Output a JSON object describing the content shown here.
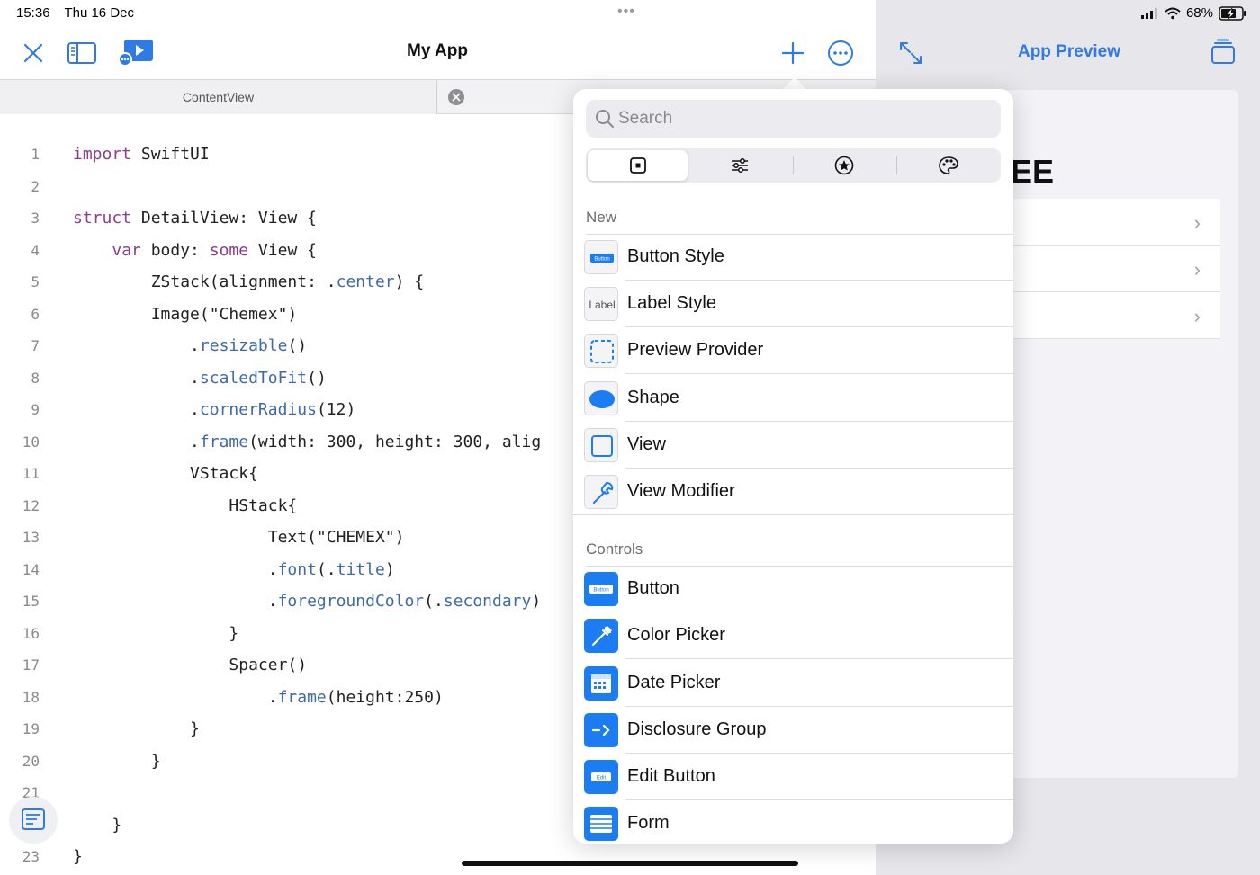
{
  "status": {
    "time": "15:36",
    "date": "Thu 16 Dec",
    "battery": "68%"
  },
  "editor": {
    "title": "My App",
    "tab_label": "ContentView",
    "code_lines": [
      {
        "n": "1",
        "text": "import SwiftUI"
      },
      {
        "n": "2",
        "text": ""
      },
      {
        "n": "3",
        "text": "struct DetailView: View {"
      },
      {
        "n": "4",
        "text": "    var body: some View {"
      },
      {
        "n": "5",
        "text": "        ZStack(alignment: .center) {"
      },
      {
        "n": "6",
        "text": "        Image(\"Chemex\")"
      },
      {
        "n": "7",
        "text": "            .resizable()"
      },
      {
        "n": "8",
        "text": "            .scaledToFit()"
      },
      {
        "n": "9",
        "text": "            .cornerRadius(12)"
      },
      {
        "n": "10",
        "text": "            .frame(width: 300, height: 300, alig"
      },
      {
        "n": "11",
        "text": "            VStack{"
      },
      {
        "n": "12",
        "text": "                HStack{"
      },
      {
        "n": "13",
        "text": "                    Text(\"CHEMEX\")"
      },
      {
        "n": "14",
        "text": "                    .font(.title)"
      },
      {
        "n": "15",
        "text": "                    .foregroundColor(.secondary)"
      },
      {
        "n": "16",
        "text": "                }"
      },
      {
        "n": "17",
        "text": "                Spacer()"
      },
      {
        "n": "18",
        "text": "                    .frame(height:250)"
      },
      {
        "n": "19",
        "text": "            }"
      },
      {
        "n": "20",
        "text": "        }"
      },
      {
        "n": "21",
        "text": ""
      },
      {
        "n": "22",
        "text": "    }"
      },
      {
        "n": "23",
        "text": "}"
      }
    ]
  },
  "preview": {
    "title": "App Preview",
    "heading_fragment": "EE"
  },
  "library": {
    "search_placeholder": "Search",
    "tabs": [
      "views-tab",
      "modifiers-tab",
      "snippets-tab",
      "colors-tab"
    ],
    "sections": [
      {
        "title": "New",
        "items": [
          {
            "label": "Button Style",
            "icon": "button-style-icon",
            "icon_text": "Button"
          },
          {
            "label": "Label Style",
            "icon": "label-style-icon",
            "icon_text": "Label"
          },
          {
            "label": "Preview Provider",
            "icon": "preview-provider-icon"
          },
          {
            "label": "Shape",
            "icon": "shape-icon"
          },
          {
            "label": "View",
            "icon": "view-icon"
          },
          {
            "label": "View Modifier",
            "icon": "view-modifier-icon"
          }
        ]
      },
      {
        "title": "Controls",
        "items": [
          {
            "label": "Button",
            "icon": "button-icon",
            "icon_text": "Button"
          },
          {
            "label": "Color Picker",
            "icon": "color-picker-icon"
          },
          {
            "label": "Date Picker",
            "icon": "date-picker-icon"
          },
          {
            "label": "Disclosure Group",
            "icon": "disclosure-group-icon"
          },
          {
            "label": "Edit Button",
            "icon": "edit-button-icon",
            "icon_text": "Edit"
          },
          {
            "label": "Form",
            "icon": "form-icon"
          }
        ]
      }
    ]
  },
  "colors": {
    "accent": "#2f7ae5",
    "icon_blue": "#1c7cf2",
    "keyword": "#8e3a8e",
    "modifier": "#3e6aa8"
  }
}
